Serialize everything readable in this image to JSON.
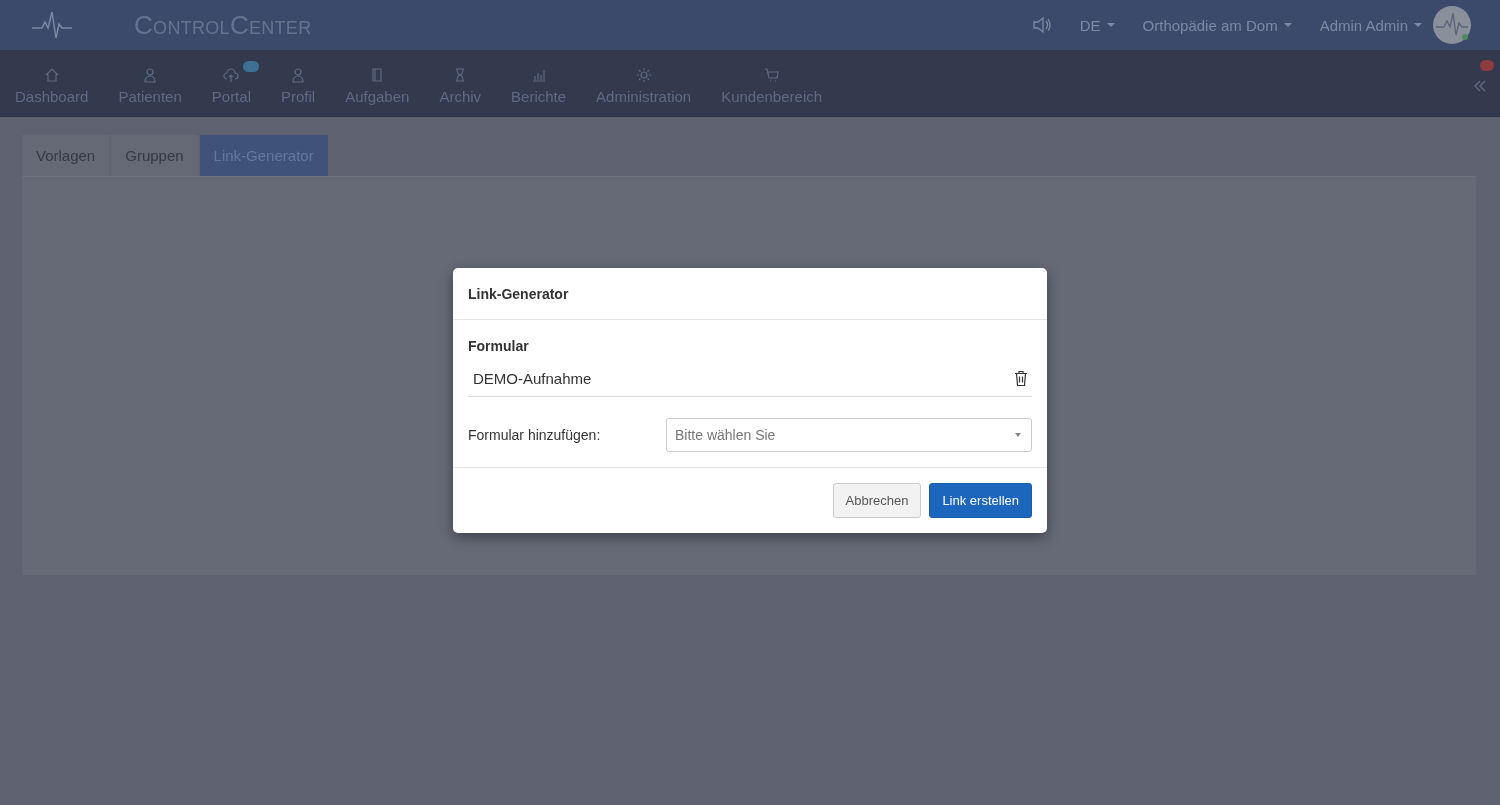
{
  "header": {
    "logo_text": "ControlCenter",
    "language": "DE",
    "practice": "Orthopädie am Dom",
    "user": "Admin Admin"
  },
  "nav": [
    {
      "label": "Dashboard",
      "badge": false
    },
    {
      "label": "Patienten",
      "badge": false
    },
    {
      "label": "Portal",
      "badge": true
    },
    {
      "label": "Profil",
      "badge": false
    },
    {
      "label": "Aufgaben",
      "badge": false
    },
    {
      "label": "Archiv",
      "badge": false
    },
    {
      "label": "Berichte",
      "badge": false
    },
    {
      "label": "Administration",
      "badge": false
    },
    {
      "label": "Kundenbereich",
      "badge": false
    }
  ],
  "notification_badge": true,
  "tabs": [
    {
      "label": "Vorlagen",
      "selected": false
    },
    {
      "label": "Gruppen",
      "selected": false
    },
    {
      "label": "Link-Generator",
      "selected": true
    }
  ],
  "dialog": {
    "title": "Link-Generator",
    "section_title": "Formular",
    "forms": [
      "DEMO-Aufnahme"
    ],
    "add_label": "Formular hinzufügen:",
    "select": {
      "placeholder": "Bitte wählen Sie"
    },
    "buttons": [
      {
        "label": "Abbrechen",
        "kind": "default"
      },
      {
        "label": "Link erstellen",
        "kind": "primary"
      }
    ]
  }
}
